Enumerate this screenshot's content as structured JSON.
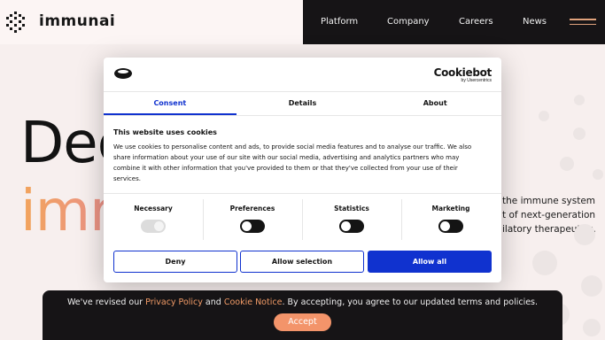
{
  "header": {
    "logo_text": "immunai",
    "nav": [
      "Platform",
      "Company",
      "Careers",
      "News"
    ]
  },
  "hero": {
    "line1": "Dec",
    "line2": "imm",
    "text_lines": [
      "the immune system",
      "t of next-generation",
      "ilatory therapeutics."
    ]
  },
  "cookie_modal": {
    "brand_name": "Cookiebot",
    "brand_sub": "by Usercentrics",
    "tabs": [
      "Consent",
      "Details",
      "About"
    ],
    "active_tab": "Consent",
    "title": "This website uses cookies",
    "body": "We use cookies to personalise content and ads, to provide social media features and to analyse our traffic. We also share information about your use of our site with our social media, advertising and analytics partners who may combine it with other information that you've provided to them or that they've collected from your use of their services.",
    "categories": [
      {
        "label": "Necessary",
        "enabled": true,
        "disabled": true
      },
      {
        "label": "Preferences",
        "enabled": false,
        "disabled": false
      },
      {
        "label": "Statistics",
        "enabled": false,
        "disabled": false
      },
      {
        "label": "Marketing",
        "enabled": false,
        "disabled": false
      }
    ],
    "buttons": {
      "deny": "Deny",
      "allow_selection": "Allow selection",
      "allow_all": "Allow all"
    },
    "accent_color": "#1032cf"
  },
  "banner": {
    "text_before": "We've revised our ",
    "privacy_link": "Privacy Policy",
    "text_and": " and ",
    "cookie_link": "Cookie Notice",
    "text_after": ". By accepting, you agree to our updated terms and policies.",
    "accept_label": "Accept",
    "accent_color": "#f3946a"
  }
}
